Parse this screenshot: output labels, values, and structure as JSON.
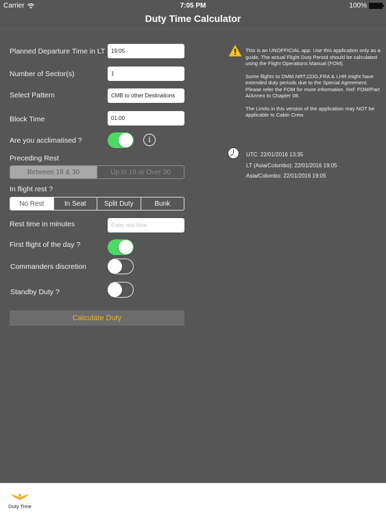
{
  "status_bar": {
    "carrier": "Carrier",
    "time": "7:05 PM",
    "battery": "100%"
  },
  "nav": {
    "title": "Duty Time Calculator"
  },
  "form": {
    "departure": {
      "label": "Planned Departure Time in LT",
      "value": "19:05"
    },
    "sectors": {
      "label": "Number of Sector(s)",
      "value": "1"
    },
    "pattern": {
      "label": "Select Pattern",
      "value": "CMB to other Destinations"
    },
    "block_time": {
      "label": "Block Time",
      "value": "01:00"
    },
    "acclimatised": {
      "label": "Are you acclimatised ?",
      "on": true
    },
    "preceding_rest": {
      "label": "Preceding Rest",
      "options": [
        "Between 18 & 30",
        "Up to 18 or Over 30"
      ],
      "selected": "Between 18 & 30"
    },
    "inflight_rest": {
      "label": "In flight rest ?",
      "options": [
        "No Rest",
        "In Seat",
        "Split Duty",
        "Bunk"
      ],
      "selected": "No Rest"
    },
    "rest_minutes": {
      "label": "Rest time in minutes",
      "value": "",
      "placeholder": "Enter rest time"
    },
    "first_flight": {
      "label": "First flight of the day ?",
      "on": true
    },
    "commanders_discretion": {
      "label": "Commanders discretion",
      "on": false
    },
    "standby": {
      "label": "Standby Duty ?",
      "on": false
    },
    "calculate_label": "Calculate Duty"
  },
  "notice": {
    "paragraphs": [
      "This is an UNOFFICIAL app. Use this application only as a guide. The actual Flight Duty Period should be calculated using the Flight Operations Manual (FOM).",
      "Some flights to DMM.NRT,CDG,FRA & LHR might have extended duty periods due to the Special Agreement. Please refer the FOM for more information. Ref: FOM/Part A/Annex to Chapter 08.",
      "The Limits in this version of the application may NOT be applicable to Cabin Crew."
    ]
  },
  "times": {
    "utc": "UTC: 22/01/2016 13:35",
    "lt": "LT (Asia/Colombo): 22/01/2016 19:05",
    "local": "Asia/Colombo: 22/01/2016 19:05"
  },
  "footer": {
    "logo_text": "Duty Time"
  },
  "colors": {
    "accent_green": "#4cd964",
    "button_text": "#e8b830",
    "background": "#565656"
  }
}
